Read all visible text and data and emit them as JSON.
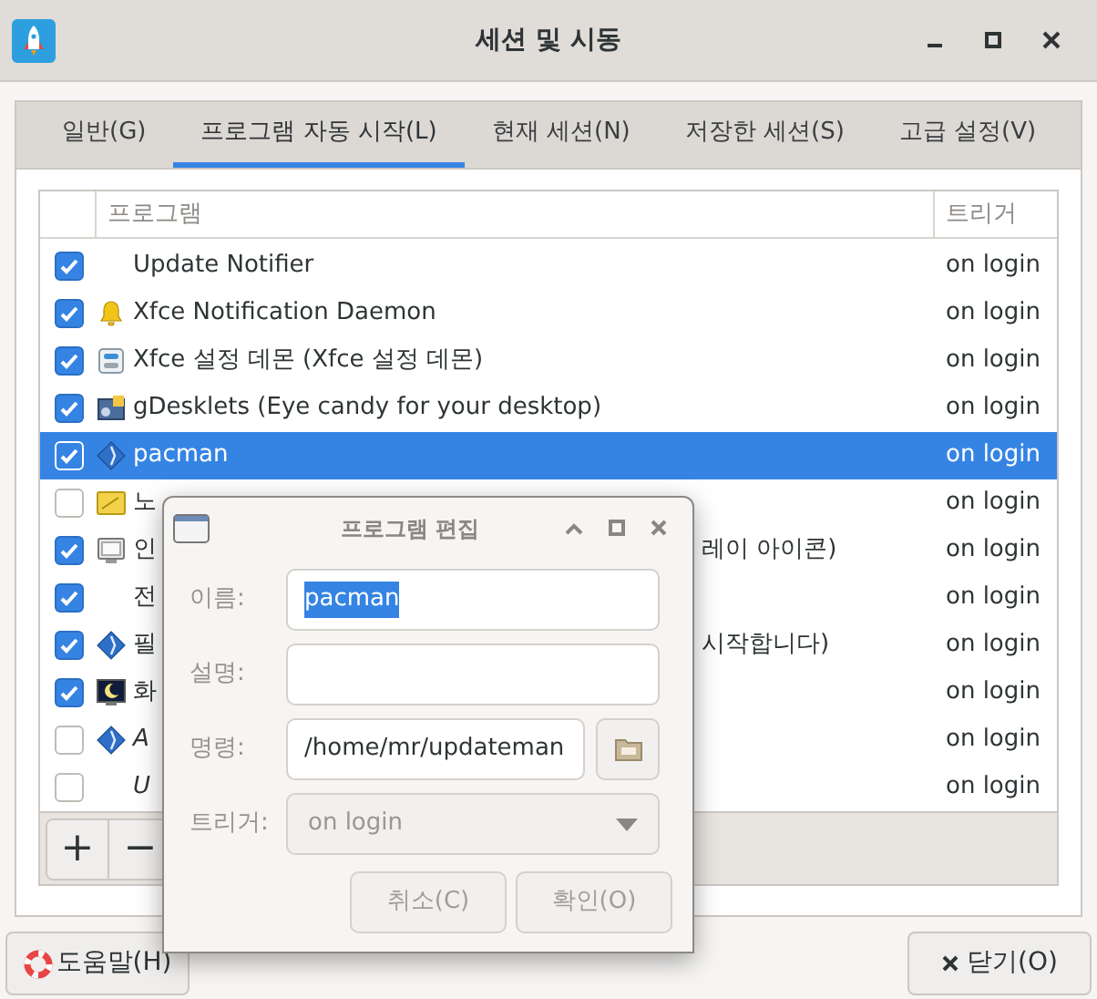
{
  "window": {
    "title": "세션 및 시동"
  },
  "tabs": [
    {
      "label": "일반(G)",
      "selected": false
    },
    {
      "label": "프로그램 자동 시작(L)",
      "selected": true
    },
    {
      "label": "현재 세션(N)",
      "selected": false
    },
    {
      "label": "저장한 세션(S)",
      "selected": false
    },
    {
      "label": "고급 설정(V)",
      "selected": false
    }
  ],
  "table": {
    "columns": [
      "프로그램",
      "트리거"
    ],
    "rows": [
      {
        "checked": true,
        "kind": "none",
        "name": "Update Notifier",
        "italic": false,
        "trigger": "on login",
        "selected": false
      },
      {
        "checked": true,
        "kind": "bell",
        "name": "Xfce Notification Daemon",
        "italic": false,
        "trigger": "on login",
        "selected": false
      },
      {
        "checked": true,
        "kind": "settings",
        "name": "Xfce 설정 데몬 (Xfce 설정 데몬)",
        "italic": false,
        "trigger": "on login",
        "selected": false
      },
      {
        "checked": true,
        "kind": "desklets",
        "name": "gDesklets (Eye candy for your desktop)",
        "italic": false,
        "trigger": "on login",
        "selected": false
      },
      {
        "checked": true,
        "kind": "diamond",
        "name": "pacman",
        "italic": false,
        "trigger": "on login",
        "selected": true
      },
      {
        "checked": false,
        "kind": "note",
        "name": "노",
        "italic": false,
        "trigger": "on login",
        "selected": false
      },
      {
        "checked": true,
        "kind": "monitor",
        "name": "인",
        "name_end": "레이 아이콘)",
        "italic": false,
        "trigger": "on login",
        "selected": false
      },
      {
        "checked": true,
        "kind": "none",
        "name": "전",
        "italic": false,
        "trigger": "on login",
        "selected": false
      },
      {
        "checked": true,
        "kind": "diamond",
        "name": "필",
        "name_end": "시작합니다)",
        "italic": false,
        "trigger": "on login",
        "selected": false
      },
      {
        "checked": true,
        "kind": "night",
        "name": "화",
        "italic": false,
        "trigger": "on login",
        "selected": false
      },
      {
        "checked": false,
        "kind": "diamond",
        "name": "A",
        "italic": true,
        "trigger": "on login",
        "selected": false
      },
      {
        "checked": false,
        "kind": "none",
        "name": "U",
        "italic": true,
        "trigger": "on login",
        "selected": false
      }
    ],
    "toolbar": [
      "+",
      "−"
    ]
  },
  "dialog": {
    "title": "프로그램 편집",
    "fields": [
      {
        "kind": "text",
        "label": "이름:",
        "value": "pacman",
        "value_selected": true
      },
      {
        "kind": "text",
        "label": "설명:"
      },
      {
        "kind": "browse",
        "label": "명령:",
        "value": "/home/mr/updateman",
        "value_selected": false
      },
      {
        "kind": "dropdown",
        "label": "트리거:",
        "value": "on login",
        "disabled": true
      }
    ],
    "buttons": [
      {
        "label": "취소(C)",
        "disabled": true
      },
      {
        "label": "확인(O)",
        "disabled": true
      }
    ]
  },
  "footer": {
    "help": "도움말(H)",
    "close": "닫기(O)"
  }
}
